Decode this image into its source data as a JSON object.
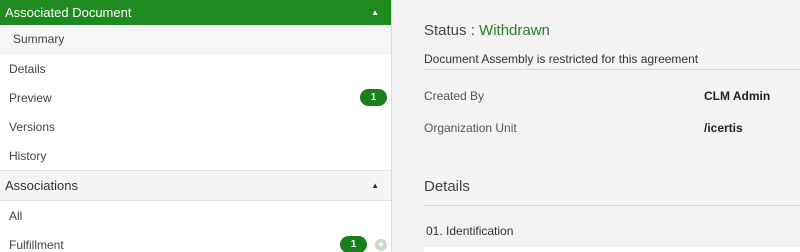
{
  "sidebar": {
    "associated_document": {
      "header": "Associated Document",
      "items": [
        {
          "label": "Summary"
        },
        {
          "label": "Details"
        },
        {
          "label": "Preview",
          "count": "1"
        },
        {
          "label": "Versions"
        },
        {
          "label": "History"
        }
      ]
    },
    "associations": {
      "header": "Associations",
      "items": [
        {
          "label": "All"
        },
        {
          "label": "Fulfillment",
          "count": "1"
        }
      ]
    }
  },
  "main": {
    "status_label": "Status :",
    "status_value": "Withdrawn",
    "restricted_message": "Document Assembly is restricted for this agreement",
    "fields": [
      {
        "label": "Created By",
        "value": "CLM Admin"
      },
      {
        "label": "Organization Unit",
        "value": "/icertis"
      }
    ],
    "details_title": "Details",
    "sub_section_title": "01. Identification"
  },
  "colors": {
    "accent": "#1f8a1f",
    "badge": "#1b7d1b",
    "status_value": "#2b7d2b"
  }
}
